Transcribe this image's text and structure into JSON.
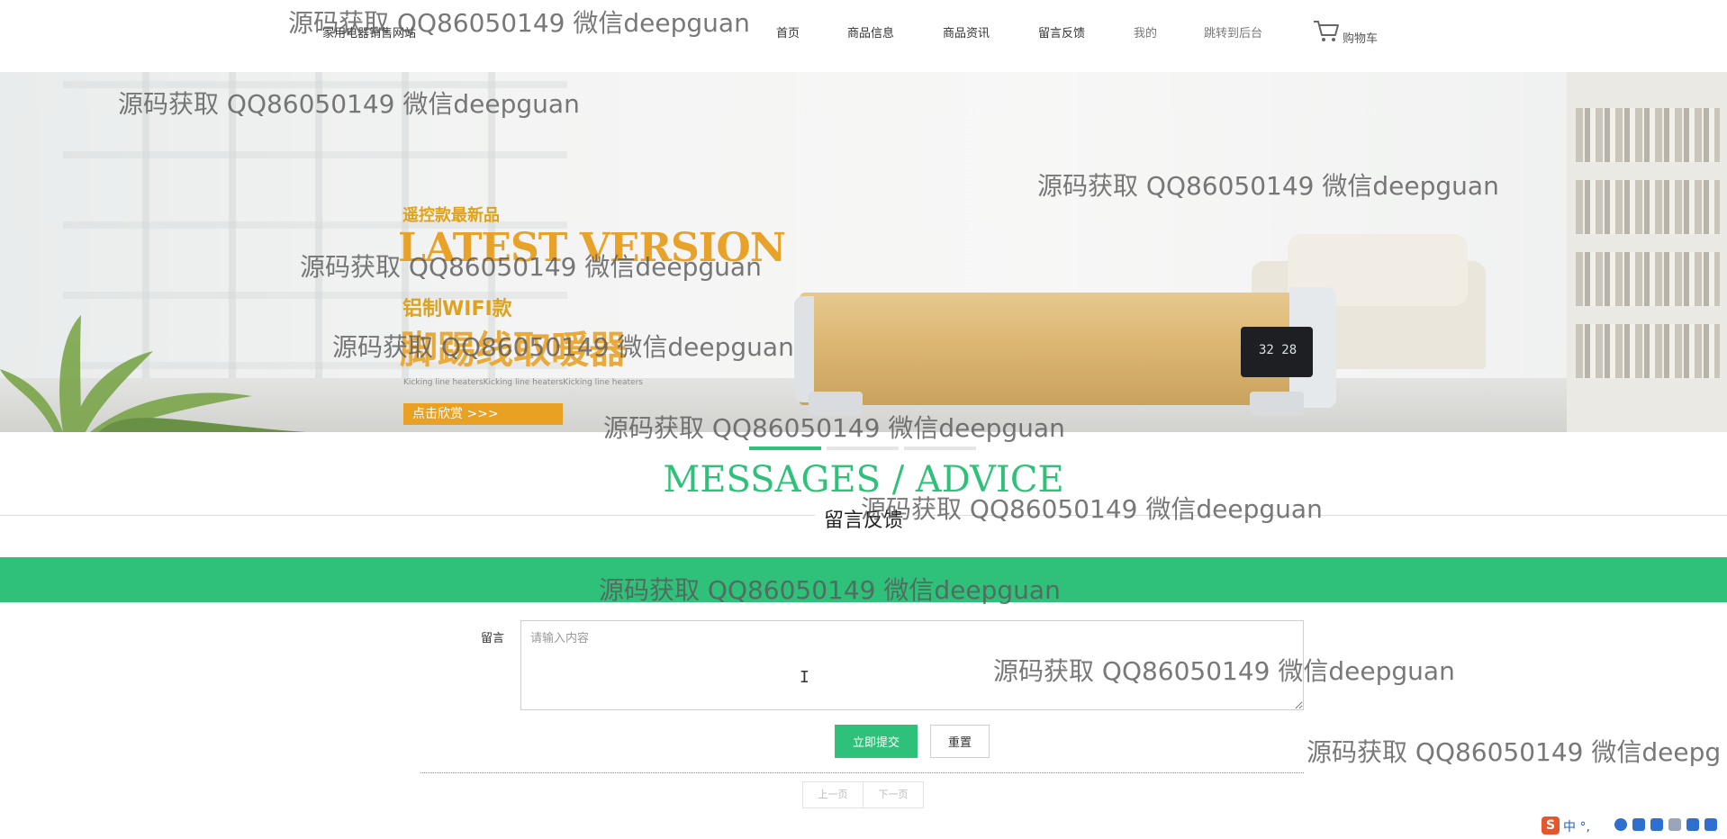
{
  "site": {
    "name": "家用电器销售网站"
  },
  "nav": {
    "items": [
      "首页",
      "商品信息",
      "商品资讯",
      "留言反馈",
      "我的",
      "跳转到后台"
    ],
    "cart_label": "购物车"
  },
  "banner": {
    "promo_small": "遥控款最新品",
    "promo_big": "LATEST VERSION",
    "promo_mid": "铝制WIFI款",
    "promo_cn": "脚踢线取暖器",
    "promo_fine": "Kicking line heatersKicking line heatersKicking line heaters",
    "promo_button": "点击欣赏  >>>",
    "display_digits": "32 28",
    "indicators": {
      "count": 3,
      "active_index": 0
    }
  },
  "section": {
    "title_en": "MESSAGES / ADVICE",
    "title_cn": "留言反馈"
  },
  "form": {
    "label": "留言",
    "textarea_placeholder": "请输入内容",
    "submit_label": "立即提交",
    "reset_label": "重置"
  },
  "pagination": {
    "prev_label": "上一页",
    "next_label": "下一页"
  },
  "watermark": {
    "text": "源码获取 QQ86050149 微信deepguan",
    "truncated_text": "源码获取 QQ86050149 微信deepg"
  },
  "ime_toolbar": {
    "text": "中 °,"
  },
  "colors": {
    "accent": "#2fc17a",
    "promo": "#e9a123"
  }
}
